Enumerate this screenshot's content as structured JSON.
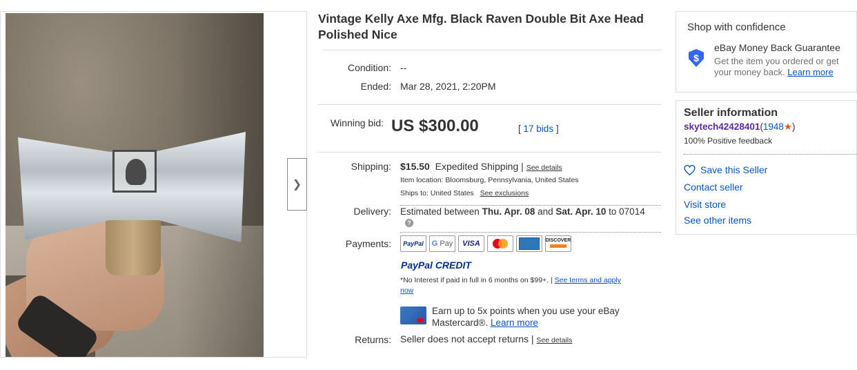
{
  "listing": {
    "title_line1": "Vintage Kelly Axe Mfg. Black Raven Double Bit Axe Head",
    "title_line2": "Polished Nice",
    "condition_label": "Condition:",
    "condition_value": "--",
    "ended_label": "Ended:",
    "ended_value": "Mar 28, 2021, 2:20PM",
    "winning_bid_label": "Winning bid:",
    "winning_bid_value": "US $300.00",
    "bids_open": "[",
    "bids_link": "17 bids",
    "bids_close": "]"
  },
  "shipping": {
    "label": "Shipping:",
    "cost": "$15.50",
    "method": "Expedited Shipping |",
    "details_link": "See details",
    "item_location": "Item location:  Bloomsburg, Pennsylvania, United States",
    "ships_to": "Ships to:  United States",
    "exclusions_link": "See exclusions"
  },
  "delivery": {
    "label": "Delivery:",
    "text_prefix": "Estimated between ",
    "date1": "Thu. Apr. 08",
    "text_mid": " and ",
    "date2": "Sat. Apr. 10",
    "text_suffix": " to 07014"
  },
  "payments": {
    "label": "Payments:",
    "icons": [
      "PayPal",
      "G Pay",
      "VISA",
      "Mastercard",
      "American Express",
      "DISCOVER"
    ],
    "paypal_credit": "PayPal CREDIT",
    "credit_note": "*No Interest if paid in full in 6 months on $99+.  |",
    "terms_link_1": "See terms and apply",
    "terms_link_2": "now",
    "mastercard_line1": "Earn up to 5x points when you use your eBay",
    "mastercard_line2": "Mastercard®.",
    "mastercard_learn": "Learn more"
  },
  "returns": {
    "label": "Returns:",
    "text": "Seller does not accept returns |",
    "details_link": "See details"
  },
  "confidence": {
    "heading": "Shop with confidence",
    "guarantee_title": "eBay Money Back Guarantee",
    "guarantee_line1": "Get the item you ordered or get",
    "guarantee_line2": "your money back.",
    "learn_more": "Learn more"
  },
  "seller": {
    "heading": "Seller information",
    "name": "skytech42428401",
    "feedback_open": "(",
    "feedback_score": "1948",
    "feedback_close": ")",
    "positive": "100% Positive feedback",
    "save": "Save this Seller",
    "contact": "Contact seller",
    "store": "Visit store",
    "other_items": "See other items"
  },
  "colors": {
    "link": "#0654ba",
    "seller_name": "#5f2a9e",
    "accent_blue": "#3665f3",
    "star": "#e8541c"
  }
}
